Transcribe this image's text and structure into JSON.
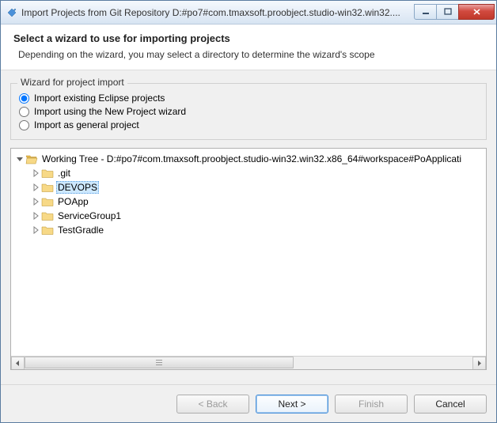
{
  "titlebar": {
    "text": "Import Projects from Git Repository D:#po7#com.tmaxsoft.proobject.studio-win32.win32...."
  },
  "header": {
    "title": "Select a wizard to use for importing projects",
    "subtitle": "Depending on the wizard, you may select a directory to determine the wizard's scope"
  },
  "group": {
    "legend": "Wizard for project import",
    "options": [
      {
        "label": "Import existing Eclipse projects",
        "checked": true
      },
      {
        "label": "Import using the New Project wizard",
        "checked": false
      },
      {
        "label": "Import as general project",
        "checked": false
      }
    ]
  },
  "tree": {
    "root": {
      "label": "Working Tree - D:#po7#com.tmaxsoft.proobject.studio-win32.win32.x86_64#workspace#PoApplicati",
      "expanded": true
    },
    "children": [
      {
        "label": ".git",
        "selected": false
      },
      {
        "label": "DEVOPS",
        "selected": true
      },
      {
        "label": "POApp",
        "selected": false
      },
      {
        "label": "ServiceGroup1",
        "selected": false
      },
      {
        "label": "TestGradle",
        "selected": false
      }
    ]
  },
  "buttons": {
    "back": "< Back",
    "next": "Next >",
    "finish": "Finish",
    "cancel": "Cancel"
  }
}
